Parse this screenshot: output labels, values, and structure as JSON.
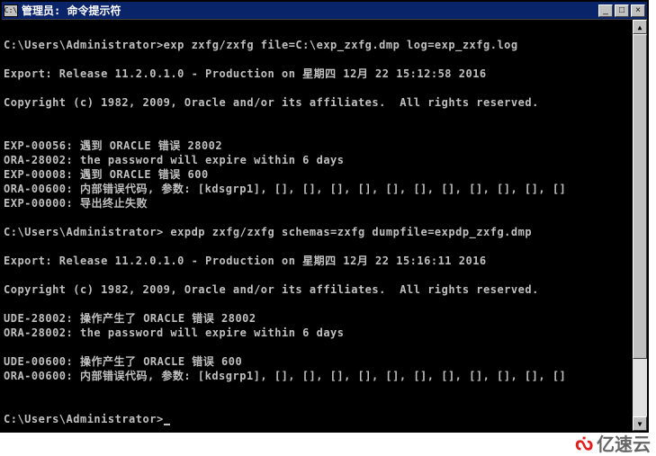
{
  "window": {
    "icon_label": "C:\\",
    "title": "管理员: 命令提示符"
  },
  "terminal": {
    "lines": [
      "",
      "C:\\Users\\Administrator>exp zxfg/zxfg file=C:\\exp_zxfg.dmp log=exp_zxfg.log",
      "",
      "Export: Release 11.2.0.1.0 - Production on 星期四 12月 22 15:12:58 2016",
      "",
      "Copyright (c) 1982, 2009, Oracle and/or its affiliates.  All rights reserved.",
      "",
      "",
      "EXP-00056: 遇到 ORACLE 错误 28002",
      "ORA-28002: the password will expire within 6 days",
      "EXP-00008: 遇到 ORACLE 错误 600",
      "ORA-00600: 内部错误代码, 参数: [kdsgrp1], [], [], [], [], [], [], [], [], [], [], []",
      "EXP-00000: 导出终止失败",
      "",
      "C:\\Users\\Administrator> expdp zxfg/zxfg schemas=zxfg dumpfile=expdp_zxfg.dmp",
      "",
      "Export: Release 11.2.0.1.0 - Production on 星期四 12月 22 15:16:11 2016",
      "",
      "Copyright (c) 1982, 2009, Oracle and/or its affiliates.  All rights reserved.",
      "",
      "UDE-28002: 操作产生了 ORACLE 错误 28002",
      "ORA-28002: the password will expire within 6 days",
      "",
      "UDE-00600: 操作产生了 ORACLE 错误 600",
      "ORA-00600: 内部错误代码, 参数: [kdsgrp1], [], [], [], [], [], [], [], [], [], [], []",
      "",
      "",
      "C:\\Users\\Administrator>"
    ]
  },
  "scroll": {
    "up_glyph": "▲",
    "down_glyph": "▼"
  },
  "title_buttons": {
    "min_glyph": "_",
    "max_glyph": "□",
    "close_glyph": "×"
  },
  "watermark": {
    "logo_glyph": "ᔔ",
    "text": "亿速云"
  }
}
